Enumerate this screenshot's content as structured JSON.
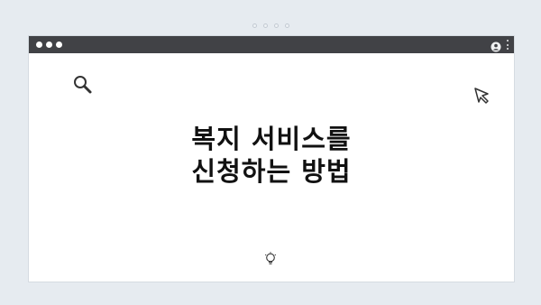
{
  "window": {
    "title": "",
    "colors": {
      "titlebar": "#414246",
      "page_background": "#e6ebf0",
      "content_background": "#ffffff"
    }
  },
  "icons": {
    "top_indicator": "pagination-dots",
    "titlebar_left": "traffic-light-dots",
    "titlebar_right_1": "profile-icon",
    "titlebar_right_2": "kebab-menu-icon",
    "content_top_left": "search-icon",
    "content_top_right": "cursor-icon",
    "content_bottom": "lightbulb-icon"
  },
  "content": {
    "heading_line1": "복지 서비스를",
    "heading_line2": "신청하는 방법"
  }
}
